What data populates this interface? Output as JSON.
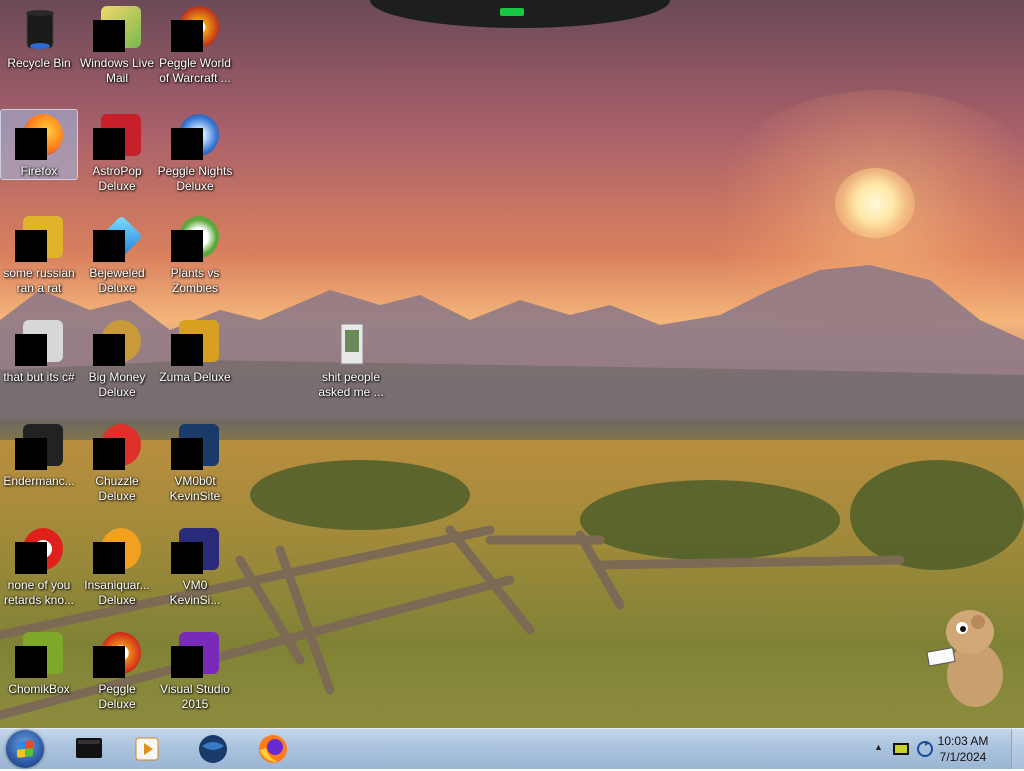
{
  "desktop": {
    "icons": [
      {
        "label": "Recycle Bin",
        "icon": "recycle-bin-icon"
      },
      {
        "label": "Windows Live Mail",
        "icon": "windows-live-mail-icon"
      },
      {
        "label": "Peggle World of Warcraft ...",
        "icon": "peggle-wow-icon"
      },
      {
        "label": "Firefox",
        "icon": "firefox-icon"
      },
      {
        "label": "AstroPop Deluxe",
        "icon": "astropop-icon"
      },
      {
        "label": "Peggle Nights Deluxe",
        "icon": "peggle-nights-icon"
      },
      {
        "label": "some russian ran a rat",
        "icon": "app-icon"
      },
      {
        "label": "Bejeweled Deluxe",
        "icon": "bejeweled-icon"
      },
      {
        "label": "Plants vs Zombies",
        "icon": "plants-vs-zombies-icon"
      },
      {
        "label": "that but its c#",
        "icon": "shortcut-icon"
      },
      {
        "label": "Big Money Deluxe",
        "icon": "big-money-icon"
      },
      {
        "label": "Zuma Deluxe",
        "icon": "zuma-icon"
      },
      {
        "label": "shit people asked me ...",
        "icon": "folder-icon"
      },
      {
        "label": "Endermanc...",
        "icon": "terminal-icon"
      },
      {
        "label": "Chuzzle Deluxe",
        "icon": "chuzzle-icon"
      },
      {
        "label": "VM0b0t KevinSite",
        "icon": "vm-icon"
      },
      {
        "label": "none of you retards kno...",
        "icon": "opera-icon"
      },
      {
        "label": "Insaniquar... Deluxe",
        "icon": "insaniquarium-icon"
      },
      {
        "label": "VM0 KevinSi...",
        "icon": "vm-icon"
      },
      {
        "label": "ChomikBox",
        "icon": "chomikbox-icon"
      },
      {
        "label": "Peggle Deluxe",
        "icon": "peggle-icon"
      },
      {
        "label": "Visual Studio 2015",
        "icon": "visual-studio-icon"
      }
    ]
  },
  "taskbar": {
    "pinned": [
      {
        "icon": "media-center-icon"
      },
      {
        "icon": "media-player-icon"
      },
      {
        "icon": "globe-icon"
      },
      {
        "icon": "firefox-icon"
      }
    ],
    "tray": {
      "time": "10:03 AM",
      "date": "7/1/2024"
    }
  },
  "colors": {
    "taskbar": "#a8c1dc",
    "label_text": "#ffffff",
    "selection": "#a0bee6"
  }
}
